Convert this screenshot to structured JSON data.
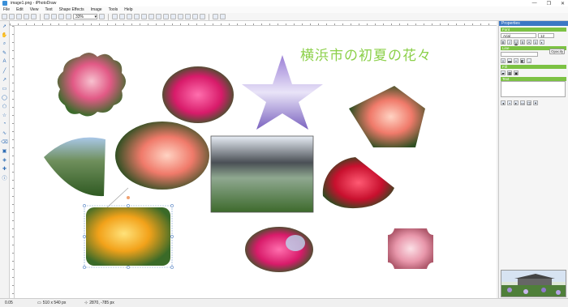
{
  "window": {
    "title": "image1.png - iPhotoDraw",
    "buttons": [
      "—",
      "❐",
      "✕"
    ]
  },
  "menu": [
    "File",
    "Edit",
    "View",
    "Text",
    "Shape Effects",
    "Image",
    "Tools",
    "Help"
  ],
  "toolbar": {
    "zoom": "33%"
  },
  "canvas": {
    "title_text": "横浜市の初夏の花々"
  },
  "panel": {
    "title": "Properties",
    "font_label": "Font",
    "font_name": "Arial",
    "font_size": "12",
    "line_label": "Line",
    "fill_label": "Fill",
    "text_label": "Text",
    "tooltip": "Opacity"
  },
  "status": {
    "zoom": "0.05",
    "size": "510 x 540 px",
    "coords": "2870, -785 px"
  },
  "colors": {
    "title_text": "#8cd04a",
    "panel_header": "#3b78c4",
    "section_header": "#7cc243"
  }
}
